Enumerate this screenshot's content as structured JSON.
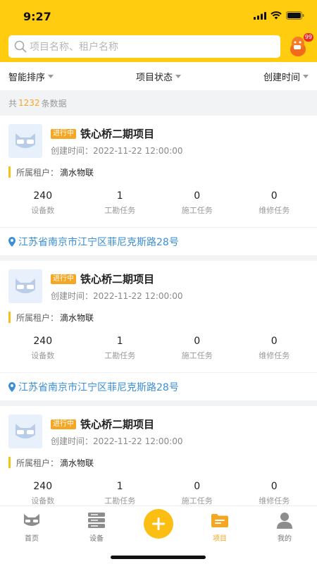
{
  "status_bar": {
    "time": "9:27"
  },
  "search": {
    "placeholder": "项目名称、租户名称"
  },
  "mascot": {
    "badge": "99"
  },
  "filters": [
    "智能排序",
    "项目状态",
    "创建时间"
  ],
  "summary": {
    "prefix": "共",
    "count": "1232",
    "suffix": "条数据"
  },
  "labels": {
    "created_prefix": "创建时间：",
    "tenant_label": "所属租户："
  },
  "projects": [
    {
      "status": "进行中",
      "name": "铁心桥二期项目",
      "created": "2022-11-22 12:00:00",
      "tenant": "滴水物联",
      "stats": [
        {
          "value": "240",
          "label": "设备数"
        },
        {
          "value": "1",
          "label": "工勘任务"
        },
        {
          "value": "0",
          "label": "施工任务"
        },
        {
          "value": "0",
          "label": "维修任务"
        }
      ],
      "address": "江苏省南京市江宁区菲尼克斯路28号"
    },
    {
      "status": "进行中",
      "name": "铁心桥二期项目",
      "created": "2022-11-22 12:00:00",
      "tenant": "滴水物联",
      "stats": [
        {
          "value": "240",
          "label": "设备数"
        },
        {
          "value": "1",
          "label": "工勘任务"
        },
        {
          "value": "0",
          "label": "施工任务"
        },
        {
          "value": "0",
          "label": "维修任务"
        }
      ],
      "address": "江苏省南京市江宁区菲尼克斯路28号"
    },
    {
      "status": "进行中",
      "name": "铁心桥二期项目",
      "created": "2022-11-22 12:00:00",
      "tenant": "滴水物联",
      "stats": [
        {
          "value": "240",
          "label": "设备数"
        },
        {
          "value": "1",
          "label": "工勘任务"
        },
        {
          "value": "0",
          "label": "施工任务"
        },
        {
          "value": "0",
          "label": "维修任务"
        }
      ]
    }
  ],
  "tabbar": {
    "items": [
      {
        "label": "首页",
        "icon": "cat-face-icon"
      },
      {
        "label": "设备",
        "icon": "server-icon"
      },
      {
        "label": "",
        "icon": "plus-icon"
      },
      {
        "label": "项目",
        "icon": "folder-icon",
        "active": true
      },
      {
        "label": "我的",
        "icon": "person-icon"
      }
    ]
  },
  "colors": {
    "brand": "#ffcc10",
    "accent": "#f5a623",
    "link": "#3a8fd8"
  }
}
